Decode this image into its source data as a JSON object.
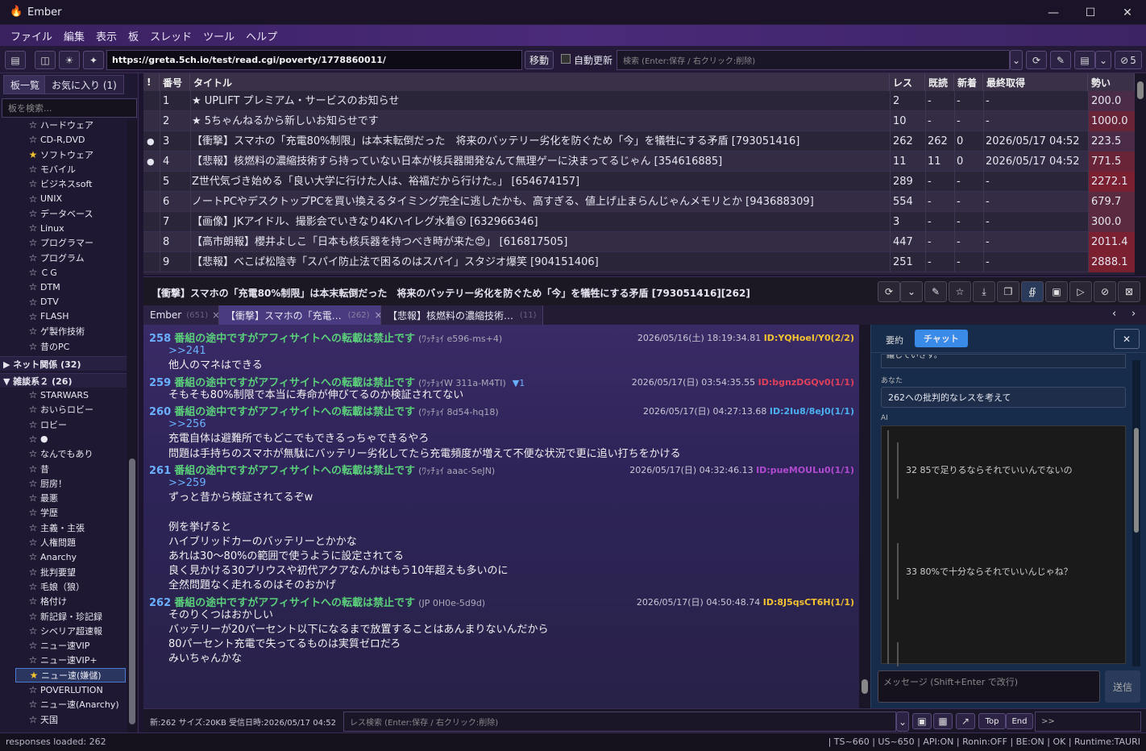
{
  "app": {
    "title": "Ember",
    "min": "—",
    "max": "☐",
    "close": "✕"
  },
  "menu": [
    "ファイル",
    "編集",
    "表示",
    "板",
    "スレッド",
    "ツール",
    "ヘルプ"
  ],
  "toolbar": {
    "url": "https://greta.5ch.io/test/read.cgi/poverty/1778860011/",
    "go": "移動",
    "auto_refresh": "自動更新",
    "search_placeholder": "検索 (Enter:保存 / 右クリック:削除)",
    "ng_count": "5"
  },
  "sidebar": {
    "tab_boards": "板一覧",
    "tab_favorites": "お気に入り (1)",
    "search_placeholder": "板を検索...",
    "items_a": [
      "ハードウェア",
      "CD-R,DVD",
      "ソフトウェア",
      "モバイル",
      "ビジネスsoft",
      "UNIX",
      "データベース",
      "Linux",
      "プログラマー",
      "プログラム",
      "ＣＧ",
      "DTM",
      "DTV",
      "FLASH",
      "ゲ製作技術",
      "昔のPC"
    ],
    "group_net": "▶ ネット関係 (32)",
    "group_misc": "▼ 雑談系２ (26)",
    "items_b": [
      "STARWARS",
      "おいらロビー",
      "ロビー",
      "●",
      "なんでもあり",
      "昔",
      "厨房！",
      "最悪",
      "学歴",
      "主義・主張",
      "人権問題",
      "Anarchy",
      "批判要望",
      "毛娘（狼）",
      "格付け",
      "新記録・珍記録",
      "シベリア超速報",
      "ニュー速VIP",
      "ニュー速VIP+",
      "ニュー速(嫌儲)",
      "POVERLUTION",
      "ニュー速(Anarchy)",
      "天国"
    ]
  },
  "threadlist": {
    "headers": {
      "mark": "!",
      "num": "番号",
      "title": "タイトル",
      "res": "レス",
      "read": "既読",
      "new": "新着",
      "fetched": "最終取得",
      "ikioi": "勢い"
    },
    "rows": [
      {
        "dot": "",
        "num": "1",
        "title": "★ UPLIFT プレミアム・サービスのお知らせ",
        "res": "2",
        "read": "-",
        "new": "-",
        "fetched": "-",
        "ikioi": "200.0"
      },
      {
        "dot": "",
        "num": "2",
        "title": "★ 5ちゃんねるから新しいお知らせです",
        "res": "10",
        "read": "-",
        "new": "-",
        "fetched": "-",
        "ikioi": "1000.0"
      },
      {
        "dot": "●",
        "num": "3",
        "title": "【衝撃】スマホの「充電80%制限」は本末転倒だった　将来のバッテリー劣化を防ぐため「今」を犠牲にする矛盾 [793051416]",
        "res": "262",
        "read": "262",
        "new": "0",
        "fetched": "2026/05/17 04:52",
        "ikioi": "223.5"
      },
      {
        "dot": "●",
        "num": "4",
        "title": "【悲報】核燃料の濃縮技術すら持っていない日本が核兵器開発なんて無理ゲーに決まってるじゃん [354616885]",
        "res": "11",
        "read": "11",
        "new": "0",
        "fetched": "2026/05/17 04:52",
        "ikioi": "771.5"
      },
      {
        "dot": "",
        "num": "5",
        "title": "Z世代気づき始める「良い大学に行けた人は、裕福だから行けた。」 [654674157]",
        "res": "289",
        "read": "-",
        "new": "-",
        "fetched": "-",
        "ikioi": "2272.1"
      },
      {
        "dot": "",
        "num": "6",
        "title": "ノートPCやデスクトップPCを買い換えるタイミング完全に逃したかも、高すぎる、値上げ止まらんじゃんメモリとか [943688309]",
        "res": "554",
        "read": "-",
        "new": "-",
        "fetched": "-",
        "ikioi": "679.7"
      },
      {
        "dot": "",
        "num": "7",
        "title": "【画像】JKアイドル、撮影会でいきなり4Kハイレグ水着😲 [632966346]",
        "res": "3",
        "read": "-",
        "new": "-",
        "fetched": "-",
        "ikioi": "300.0"
      },
      {
        "dot": "",
        "num": "8",
        "title": "【高市朗報】櫻井よしこ「日本も核兵器を持つべき時が来た😍」 [616817505]",
        "res": "447",
        "read": "-",
        "new": "-",
        "fetched": "-",
        "ikioi": "2011.4"
      },
      {
        "dot": "",
        "num": "9",
        "title": "【悲報】べこぱ松陰寺「スパイ防止法で困るのはスパイ」スタジオ爆笑 [904151406]",
        "res": "251",
        "read": "-",
        "new": "-",
        "fetched": "-",
        "ikioi": "2888.1"
      }
    ]
  },
  "thread": {
    "title": "【衝撃】スマホの「充電80%制限」は本末転倒だった　将来のバッテリー劣化を防ぐため「今」を犠牲にする矛盾 [793051416][262]",
    "tabs": [
      {
        "label": "Ember",
        "count": "(651)"
      },
      {
        "label": "【衝撃】スマホの「充電…",
        "count": "(262)"
      },
      {
        "label": "【悲報】核燃料の濃縮技術…",
        "count": "(11)"
      }
    ],
    "tab_close": "×"
  },
  "posts": [
    {
      "num": "258",
      "name": "番組の途中ですがアフィサイトへの転載は禁止です",
      "trip": "(ﾜｯﾁｮｲ e596-ms+4)",
      "extra": "",
      "date": "2026/05/16(土) 18:19:34.81",
      "id": "ID:YQHoeI/Y0(2/2)",
      "idcolor": "#f2c230",
      "lines": [
        ">>241",
        "他人のマネはできる"
      ]
    },
    {
      "num": "259",
      "name": "番組の途中ですがアフィサイトへの転載は禁止です",
      "trip": "(ﾜｯﾁｮｲW 311a-M4TI)",
      "extra": "▼1",
      "date": "2026/05/17(日) 03:54:35.55",
      "id": "ID:bgnzDGQv0(1/1)",
      "idcolor": "#e0405a",
      "lines": [
        "そもそも80%制限で本当に寿命が伸びてるのか検証されてない"
      ]
    },
    {
      "num": "260",
      "name": "番組の途中ですがアフィサイトへの転載は禁止です",
      "trip": "(ﾜｯﾁｮｲ 8d54-hq18)",
      "extra": "",
      "date": "2026/05/17(日) 04:27:13.68",
      "id": "ID:2Iu8/8eJ0(1/1)",
      "idcolor": "#4ab0f0",
      "lines": [
        ">>256",
        "充電自体は避難所でもどこでもできるっちゃできるやろ",
        "問題は手持ちのスマホが無駄にバッテリー劣化してたら充電頻度が増えて不便な状況で更に追い打ちをかける"
      ]
    },
    {
      "num": "261",
      "name": "番組の途中ですがアフィサイトへの転載は禁止です",
      "trip": "(ﾜｯﾁｮｲ aaac-SeJN)",
      "extra": "",
      "date": "2026/05/17(日) 04:32:46.13",
      "id": "ID:pueMOULu0(1/1)",
      "idcolor": "#b04ad0",
      "lines": [
        ">>259",
        "ずっと昔から検証されてるぞw",
        "",
        "例を挙げると",
        "ハイブリッドカーのバッテリーとかかな",
        "あれは30～80%の範囲で使うように設定されてる",
        "良く見かける30プリウスや初代アクアなんかはもう10年超えも多いのに",
        "全然問題なく走れるのはそのおかげ"
      ]
    },
    {
      "num": "262",
      "name": "番組の途中ですがアフィサイトへの転載は禁止です",
      "trip": "(JP 0H0e-5d9d)",
      "extra": "",
      "date": "2026/05/17(日) 04:50:48.74",
      "id": "ID:8J5qsCT6H(1/1)",
      "idcolor": "#f2c230",
      "lines": [
        "そのりくつはおかしい",
        "バッテリーが20パーセント以下になるまで放置することはあんまりないんだから",
        "80パーセント充電で失ってるものは実質ゼロだろ",
        "みいちゃんかな"
      ]
    }
  ],
  "chat": {
    "tab_summary": "要約",
    "tab_chat": "チャット",
    "close": "✕",
    "truncated": "議していきす。",
    "you_label": "あなた",
    "you_msg": "262への批判的なレスを考えて",
    "ai_label": "AI",
    "ai_line1": "32 85で足りるならそれでいいんでないの",
    "ai_line2": "33 80%で十分ならそれでいいんじゃね？",
    "input_placeholder": "メッセージ (Shift+Enter で改行)",
    "send": "送信"
  },
  "bottom": {
    "info": "新:262 サイズ:20KB 受信日時:2026/05/17 04:52",
    "search_placeholder": "レス検索 (Enter:保存 / 右クリック:削除)",
    "top": "Top",
    "end": "End",
    "jump": ">>"
  },
  "status": {
    "left": "responses loaded: 262",
    "right": "| TS~660 | US~650 | API:ON | Ronin:OFF | BE:ON | OK | Runtime:TAURI"
  }
}
